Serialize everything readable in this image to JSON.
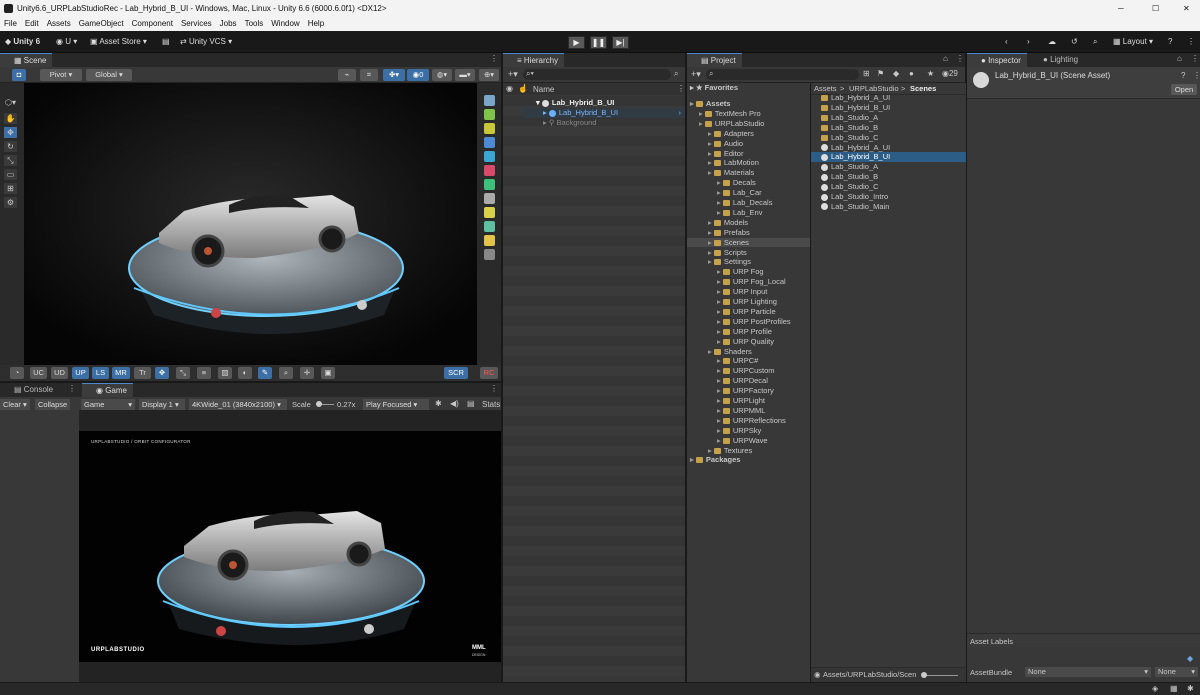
{
  "window": {
    "title": "Unity6.6_URPLabStudioRec - Lab_Hybrid_B_UI - Windows, Mac, Linux - Unity 6.6 (6000.6.0f1) <DX12>",
    "controls": [
      "─",
      "☐",
      "✕"
    ]
  },
  "menu": [
    "File",
    "Edit",
    "Assets",
    "GameObject",
    "Component",
    "Services",
    "Jobs",
    "Tools",
    "Window",
    "Help"
  ],
  "toolbar": {
    "unity_label": "Unity 6",
    "account_label": "U",
    "asset_store_label": "Asset Store",
    "vcs_label": "Unity VCS",
    "layout_label": "Layout",
    "play_glyphs": [
      "▶",
      "❚❚",
      "▶|"
    ]
  },
  "scene": {
    "tab_label": "Scene",
    "pivot_label": "Pivot",
    "global_label": "Global",
    "gizmo_count": "0",
    "bottom_buttons": [
      "UC",
      "UD",
      "UP",
      "LS",
      "MR",
      "Tr"
    ],
    "scr_label": "SCR",
    "rc_label": "RC"
  },
  "console": {
    "tab_label": "Console",
    "clear_label": "Clear",
    "collapse_label": "Collapse"
  },
  "game": {
    "tab_label": "Game",
    "mode_label": "Game",
    "display_label": "Display 1",
    "resolution_label": "4KWide_01 (3840x2100)",
    "scale_label": "Scale",
    "scale_value": "0.27x",
    "play_focused_label": "Play Focused",
    "stats_label": "Stats",
    "overlay_title": "URPLABSTUDIO / ORBIT CONFIGURATOR",
    "logo_text": "URPLABSTUDIO",
    "badge_text": "MML",
    "badge_sub": "DESIGN"
  },
  "hierarchy": {
    "tab_label": "Hierarchy",
    "name_header": "Name",
    "items": [
      {
        "label": "Lab_Hybrid_B_UI",
        "indent": 0,
        "kind": "scene"
      },
      {
        "label": "Lab_Hybrid_B_UI",
        "indent": 1,
        "kind": "selected"
      },
      {
        "label": "Background",
        "indent": 1,
        "kind": "dim"
      }
    ]
  },
  "project": {
    "tab_label": "Project",
    "hidden_count": "29",
    "favorites_label": "Favorites",
    "tree": [
      {
        "label": "Assets",
        "indent": 0,
        "bold": true
      },
      {
        "label": "TextMesh Pro",
        "indent": 1
      },
      {
        "label": "URPLabStudio",
        "indent": 1
      },
      {
        "label": "Adapters",
        "indent": 2
      },
      {
        "label": "Audio",
        "indent": 2
      },
      {
        "label": "Editor",
        "indent": 2
      },
      {
        "label": "LabMotion",
        "indent": 2
      },
      {
        "label": "Materials",
        "indent": 2
      },
      {
        "label": "Decals",
        "indent": 3
      },
      {
        "label": "Lab_Car",
        "indent": 3
      },
      {
        "label": "Lab_Decals",
        "indent": 3
      },
      {
        "label": "Lab_Env",
        "indent": 3
      },
      {
        "label": "Models",
        "indent": 2
      },
      {
        "label": "Prefabs",
        "indent": 2
      },
      {
        "label": "Scenes",
        "indent": 2,
        "highlight": true
      },
      {
        "label": "Scripts",
        "indent": 2
      },
      {
        "label": "Settings",
        "indent": 2
      },
      {
        "label": "URP Fog",
        "indent": 3
      },
      {
        "label": "URP Fog_Local",
        "indent": 3
      },
      {
        "label": "URP Input",
        "indent": 3
      },
      {
        "label": "URP Lighting",
        "indent": 3
      },
      {
        "label": "URP Particle",
        "indent": 3
      },
      {
        "label": "URP PostProfiles",
        "indent": 3
      },
      {
        "label": "URP Profile",
        "indent": 3
      },
      {
        "label": "URP Quality",
        "indent": 3
      },
      {
        "label": "Shaders",
        "indent": 2
      },
      {
        "label": "URPC#",
        "indent": 3
      },
      {
        "label": "URPCustom",
        "indent": 3
      },
      {
        "label": "URPDecal",
        "indent": 3
      },
      {
        "label": "URPFactory",
        "indent": 3
      },
      {
        "label": "URPLight",
        "indent": 3
      },
      {
        "label": "URPMML",
        "indent": 3
      },
      {
        "label": "URPReflections",
        "indent": 3
      },
      {
        "label": "URPSky",
        "indent": 3
      },
      {
        "label": "URPWave",
        "indent": 3
      },
      {
        "label": "Textures",
        "indent": 2
      },
      {
        "label": "Packages",
        "indent": 0,
        "bold": true
      }
    ],
    "breadcrumb": [
      "Assets",
      "URPLabStudio",
      "Scenes"
    ],
    "files": [
      {
        "label": "Lab_Hybrid_A_UI",
        "kind": "folder"
      },
      {
        "label": "Lab_Hybrid_B_UI",
        "kind": "folder"
      },
      {
        "label": "Lab_Studio_A",
        "kind": "folder"
      },
      {
        "label": "Lab_Studio_B",
        "kind": "folder"
      },
      {
        "label": "Lab_Studio_C",
        "kind": "folder"
      },
      {
        "label": "Lab_Hybrid_A_UI",
        "kind": "scene"
      },
      {
        "label": "Lab_Hybrid_B_UI",
        "kind": "scene",
        "selected": true
      },
      {
        "label": "Lab_Studio_A",
        "kind": "scene"
      },
      {
        "label": "Lab_Studio_B",
        "kind": "scene"
      },
      {
        "label": "Lab_Studio_C",
        "kind": "scene"
      },
      {
        "label": "Lab_Studio_Intro",
        "kind": "scene"
      },
      {
        "label": "Lab_Studio_Main",
        "kind": "scene"
      }
    ],
    "footer_path": "Assets/URPLabStudio/Scen"
  },
  "inspector": {
    "tab_label": "Inspector",
    "lighting_tab_label": "Lighting",
    "asset_title": "Lab_Hybrid_B_UI (Scene Asset)",
    "open_label": "Open",
    "asset_labels": "Asset Labels",
    "assetbundle_label": "AssetBundle",
    "bundle_value": "None",
    "variant_value": "None"
  }
}
